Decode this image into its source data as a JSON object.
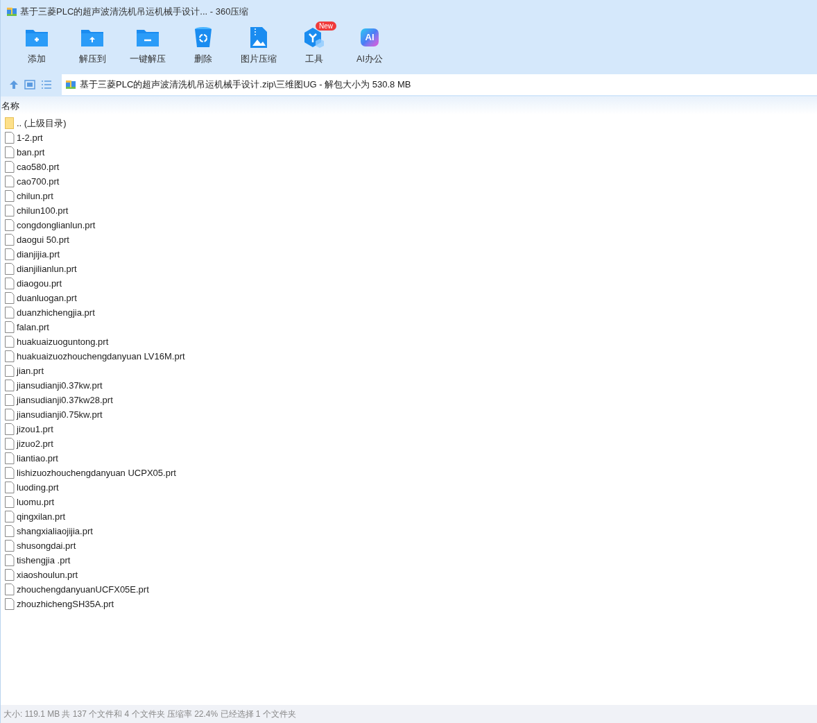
{
  "window": {
    "title": "基于三菱PLC的超声波清洗机吊运机械手设计... - 360压缩"
  },
  "toolbar": [
    {
      "kind": "add",
      "label": "添加"
    },
    {
      "kind": "extract",
      "label": "解压到"
    },
    {
      "kind": "oneclick",
      "label": "一键解压"
    },
    {
      "kind": "delete",
      "label": "删除"
    },
    {
      "kind": "image",
      "label": "图片压缩"
    },
    {
      "kind": "tools",
      "label": "工具",
      "badge": "New"
    },
    {
      "kind": "ai",
      "label": "AI办公",
      "icon_text": "AI"
    }
  ],
  "address": {
    "path": "基于三菱PLC的超声波清洗机吊运机械手设计.zip\\三维图UG - 解包大小为 530.8 MB"
  },
  "table": {
    "columns": [
      "名称"
    ],
    "rows": [
      {
        "kind": "folder",
        "name": ".. (上级目录)"
      },
      {
        "kind": "file",
        "name": "1-2.prt"
      },
      {
        "kind": "file",
        "name": "ban.prt"
      },
      {
        "kind": "file",
        "name": "cao580.prt"
      },
      {
        "kind": "file",
        "name": "cao700.prt"
      },
      {
        "kind": "file",
        "name": "chilun.prt"
      },
      {
        "kind": "file",
        "name": "chilun100.prt"
      },
      {
        "kind": "file",
        "name": "congdonglianlun.prt"
      },
      {
        "kind": "file",
        "name": "daogui 50.prt"
      },
      {
        "kind": "file",
        "name": "dianjijia.prt"
      },
      {
        "kind": "file",
        "name": "dianjilianlun.prt"
      },
      {
        "kind": "file",
        "name": "diaogou.prt"
      },
      {
        "kind": "file",
        "name": "duanluogan.prt"
      },
      {
        "kind": "file",
        "name": "duanzhichengjia.prt"
      },
      {
        "kind": "file",
        "name": "falan.prt"
      },
      {
        "kind": "file",
        "name": "huakuaizuoguntong.prt"
      },
      {
        "kind": "file",
        "name": "huakuaizuozhouchengdanyuan LV16M.prt"
      },
      {
        "kind": "file",
        "name": "jian.prt"
      },
      {
        "kind": "file",
        "name": "jiansudianji0.37kw.prt"
      },
      {
        "kind": "file",
        "name": "jiansudianji0.37kw28.prt"
      },
      {
        "kind": "file",
        "name": "jiansudianji0.75kw.prt"
      },
      {
        "kind": "file",
        "name": "jizou1.prt"
      },
      {
        "kind": "file",
        "name": "jizuo2.prt"
      },
      {
        "kind": "file",
        "name": "liantiao.prt"
      },
      {
        "kind": "file",
        "name": "lishizuozhouchengdanyuan UCPX05.prt"
      },
      {
        "kind": "file",
        "name": "luoding.prt"
      },
      {
        "kind": "file",
        "name": "luomu.prt"
      },
      {
        "kind": "file",
        "name": "qingxilan.prt"
      },
      {
        "kind": "file",
        "name": "shangxialiaojijia.prt"
      },
      {
        "kind": "file",
        "name": "shusongdai.prt"
      },
      {
        "kind": "file",
        "name": "tishengjia .prt"
      },
      {
        "kind": "file",
        "name": "xiaoshoulun.prt"
      },
      {
        "kind": "file",
        "name": "zhouchengdanyuanUCFX05E.prt"
      },
      {
        "kind": "file",
        "name": "zhouzhichengSH35A.prt"
      }
    ]
  },
  "status_bar": "大小: 119.1 MB 共 137 个文件和 4 个文件夹 压缩率 22.4% 已经选择 1 个文件夹"
}
